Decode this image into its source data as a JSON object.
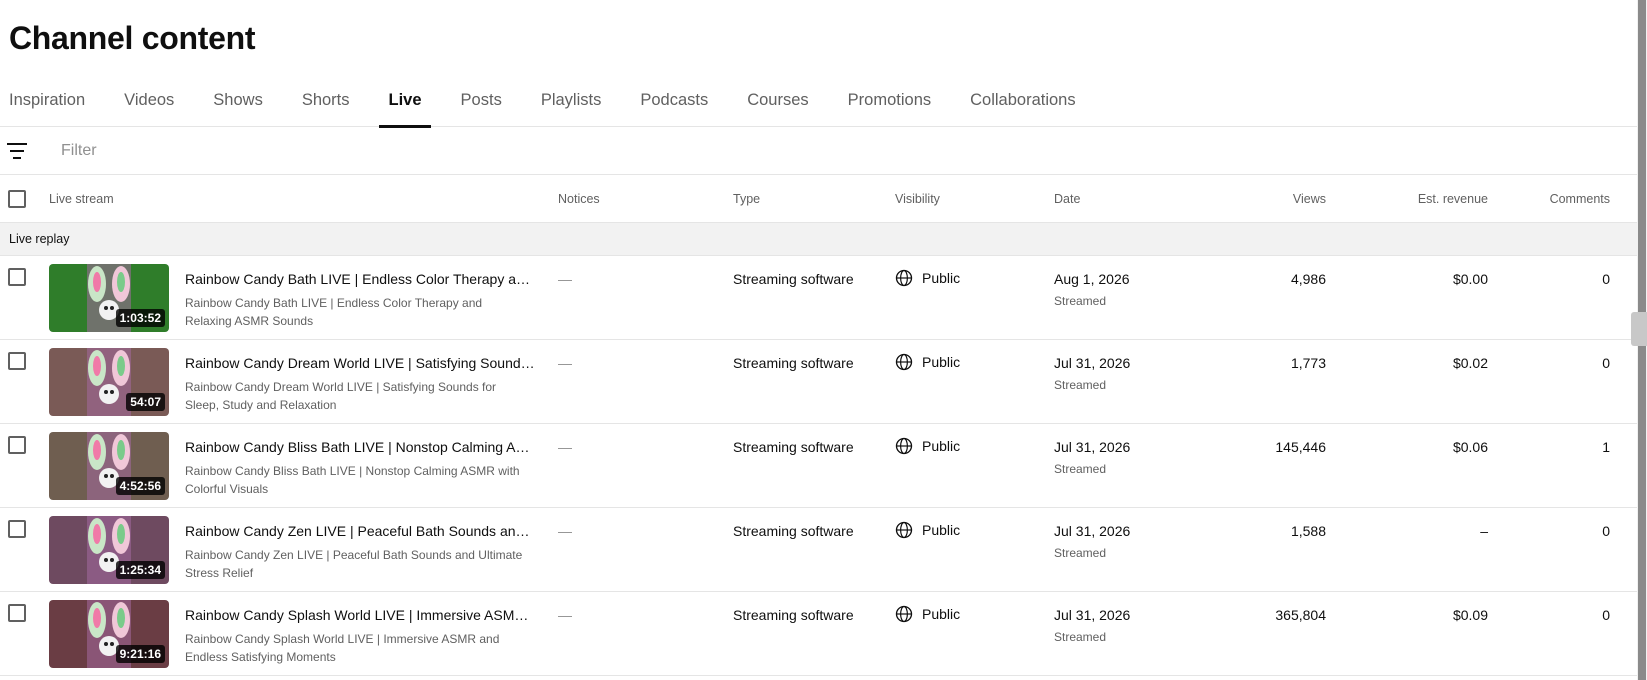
{
  "page": {
    "title": "Channel content"
  },
  "tabs": [
    {
      "label": "Inspiration",
      "active": false
    },
    {
      "label": "Videos",
      "active": false
    },
    {
      "label": "Shows",
      "active": false
    },
    {
      "label": "Shorts",
      "active": false
    },
    {
      "label": "Live",
      "active": true
    },
    {
      "label": "Posts",
      "active": false
    },
    {
      "label": "Playlists",
      "active": false
    },
    {
      "label": "Podcasts",
      "active": false
    },
    {
      "label": "Courses",
      "active": false
    },
    {
      "label": "Promotions",
      "active": false
    },
    {
      "label": "Collaborations",
      "active": false
    }
  ],
  "filter": {
    "placeholder": "Filter",
    "icon": "filter-icon"
  },
  "table": {
    "headers": {
      "live_stream": "Live stream",
      "notices": "Notices",
      "type": "Type",
      "visibility": "Visibility",
      "date": "Date",
      "views": "Views",
      "revenue": "Est. revenue",
      "comments": "Comments"
    },
    "section_label": "Live replay",
    "rows": [
      {
        "title": "Rainbow Candy Bath LIVE | Endless Color Therapy and Relaxing ASMR Sounds",
        "description": "Rainbow Candy Bath LIVE | Endless Color Therapy and Relaxing ASMR Sounds",
        "duration": "1:03:52",
        "notice": "—",
        "type": "Streaming software",
        "visibility": "Public",
        "date": "Aug 1, 2026",
        "date_sub": "Streamed",
        "views": "4,986",
        "revenue": "$0.00",
        "comments": "0",
        "thumb_bg": "#2f7d2a"
      },
      {
        "title": "Rainbow Candy Dream World LIVE | Satisfying Sounds for Sleep, Study and Relaxation",
        "description": "Rainbow Candy Dream World LIVE | Satisfying Sounds for Sleep, Study and Relaxation",
        "duration": "54:07",
        "notice": "—",
        "type": "Streaming software",
        "visibility": "Public",
        "date": "Jul 31, 2026",
        "date_sub": "Streamed",
        "views": "1,773",
        "revenue": "$0.02",
        "comments": "0",
        "thumb_bg": "#7a5a56"
      },
      {
        "title": "Rainbow Candy Bliss Bath LIVE | Nonstop Calming ASMR with Colorful Visuals",
        "description": "Rainbow Candy Bliss Bath LIVE | Nonstop Calming ASMR with Colorful Visuals",
        "duration": "4:52:56",
        "notice": "—",
        "type": "Streaming software",
        "visibility": "Public",
        "date": "Jul 31, 2026",
        "date_sub": "Streamed",
        "views": "145,446",
        "revenue": "$0.06",
        "comments": "1",
        "thumb_bg": "#6f5e50"
      },
      {
        "title": "Rainbow Candy Zen LIVE | Peaceful Bath Sounds and Ultimate Stress Relief",
        "description": "Rainbow Candy Zen LIVE | Peaceful Bath Sounds and Ultimate Stress Relief",
        "duration": "1:25:34",
        "notice": "—",
        "type": "Streaming software",
        "visibility": "Public",
        "date": "Jul 31, 2026",
        "date_sub": "Streamed",
        "views": "1,588",
        "revenue": "–",
        "comments": "0",
        "thumb_bg": "#6e4a60"
      },
      {
        "title": "Rainbow Candy Splash World LIVE | Immersive ASMR and Endless Satisfying Moments",
        "description": "Rainbow Candy Splash World LIVE | Immersive ASMR and Endless Satisfying Moments",
        "duration": "9:21:16",
        "notice": "—",
        "type": "Streaming software",
        "visibility": "Public",
        "date": "Jul 31, 2026",
        "date_sub": "Streamed",
        "views": "365,804",
        "revenue": "$0.09",
        "comments": "0",
        "thumb_bg": "#6a3d44"
      }
    ]
  }
}
